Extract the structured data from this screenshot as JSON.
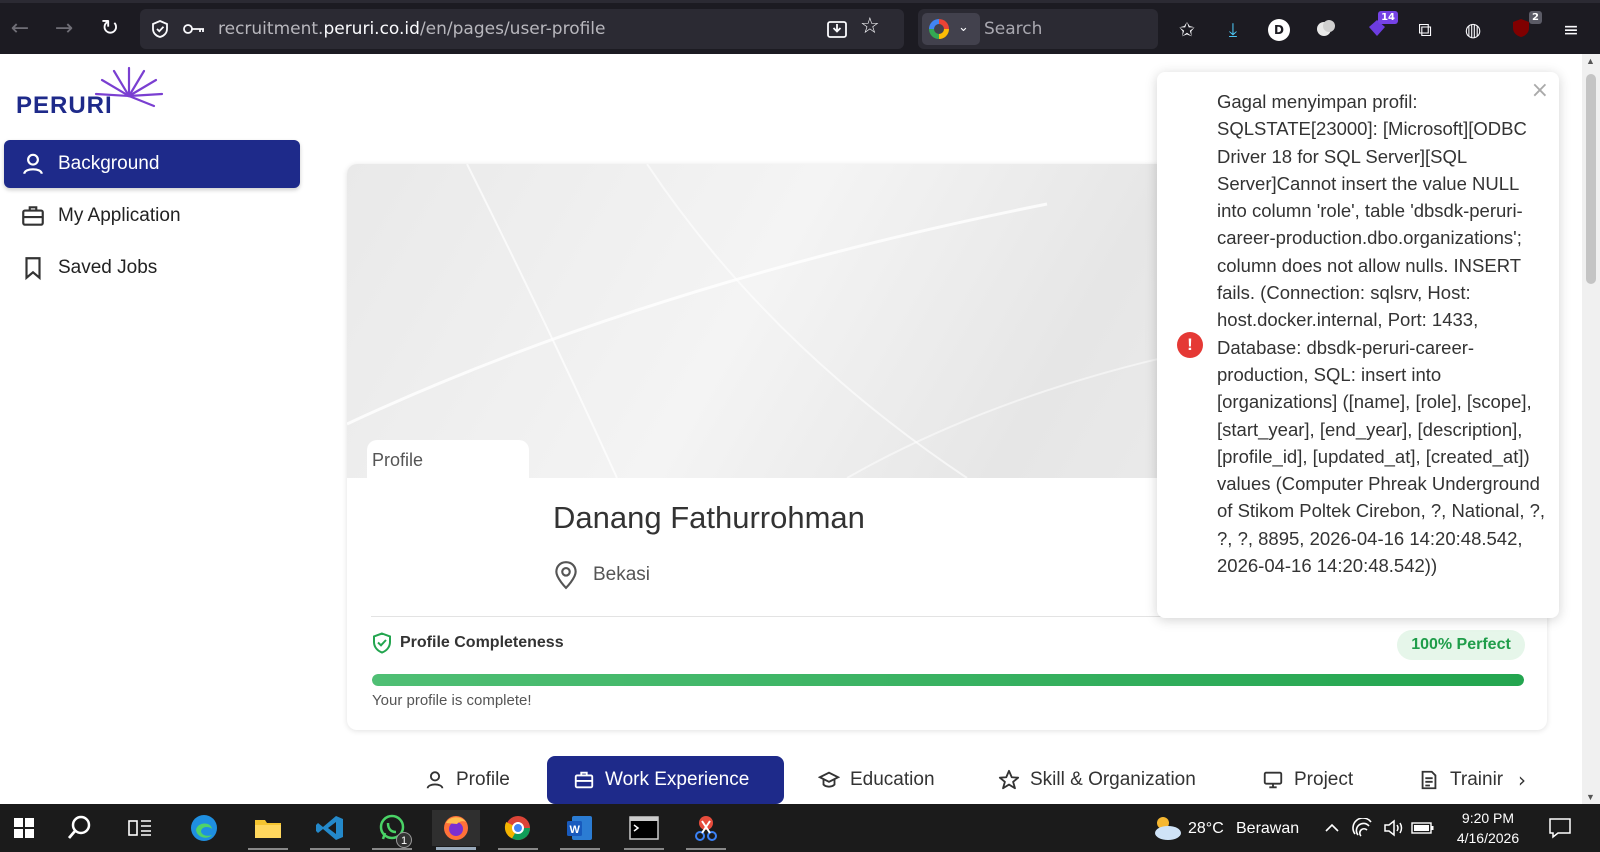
{
  "browser": {
    "url_prefix": "recruitment.",
    "url_domain": "peruri.co.id",
    "url_path": "/en/pages/user-profile",
    "search_placeholder": "Search",
    "ext_badge_1": "14",
    "ext_badge_2": "2",
    "avatar_letter": "D"
  },
  "logo": {
    "text": "PERURI"
  },
  "sidebar": {
    "items": [
      {
        "label": "Background",
        "icon": "user-icon"
      },
      {
        "label": "My Application",
        "icon": "briefcase-icon"
      },
      {
        "label": "Saved Jobs",
        "icon": "bookmark-icon"
      }
    ]
  },
  "profile": {
    "tab_label": "Profile",
    "name": "Danang Fathurrohman",
    "location": "Bekasi",
    "completeness_label": "Profile Completeness",
    "completeness_badge": "100% Perfect",
    "completeness_value": 1.0,
    "completeness_message": "Your profile is complete!"
  },
  "tabs": [
    {
      "label": "Profile",
      "icon": "user-icon"
    },
    {
      "label": "Work Experience",
      "icon": "briefcase-icon",
      "active": true
    },
    {
      "label": "Education",
      "icon": "graduation-cap-icon"
    },
    {
      "label": "Skill & Organization",
      "icon": "star-icon"
    },
    {
      "label": "Project",
      "icon": "monitor-icon"
    },
    {
      "label": "Trainir",
      "icon": "document-icon"
    }
  ],
  "toast": {
    "message": "Gagal menyimpan profil: SQLSTATE[23000]: [Microsoft][ODBC Driver 18 for SQL Server][SQL Server]Cannot insert the value NULL into column 'role', table 'dbsdk-peruri-career-production.dbo.organizations'; column does not allow nulls. INSERT fails. (Connection: sqlsrv, Host: host.docker.internal, Port: 1433, Database: dbsdk-peruri-career-production, SQL: insert into [organizations] ([name], [role], [scope], [start_year], [end_year], [description], [profile_id], [updated_at], [created_at]) values (Computer Phreak Underground of Stikom Poltek Cirebon, ?, National, ?, ?, ?, 8895, 2026-04-16 14:20:48.542, 2026-04-16 14:20:48.542))",
    "close": "×",
    "icon_glyph": "!"
  },
  "taskbar": {
    "weather_temp": "28°C",
    "weather_desc": "Berawan",
    "time": "9:20 PM",
    "date": "4/16/2026",
    "whatsapp_badge": "1"
  },
  "colors": {
    "brand_primary": "#1e2a8a",
    "success": "#23a54f",
    "error": "#e53935"
  }
}
